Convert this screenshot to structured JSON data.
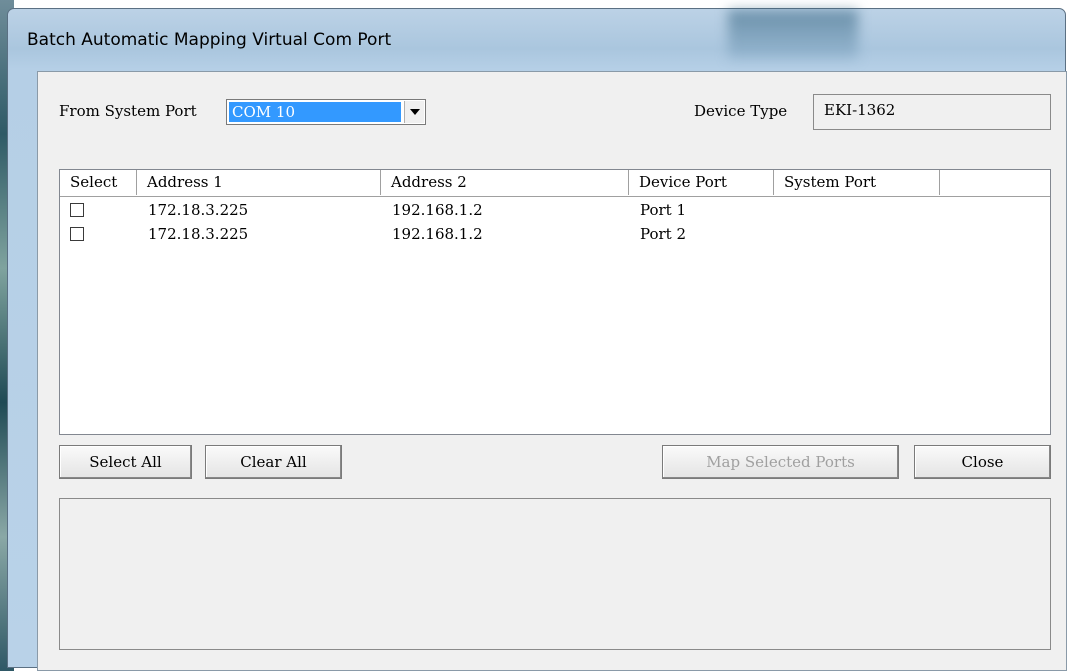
{
  "window": {
    "title": "Batch Automatic Mapping Virtual Com Port"
  },
  "form": {
    "from_system_port_label": "From System Port",
    "from_system_port_value": "COM 10",
    "device_type_label": "Device Type",
    "device_type_value": "EKI-1362"
  },
  "table": {
    "columns": [
      "Select",
      "Address 1",
      "Address 2",
      "Device Port",
      "System Port"
    ],
    "rows": [
      {
        "checked": false,
        "address1": "172.18.3.225",
        "address2": "192.168.1.2",
        "device_port": "Port 1",
        "system_port": ""
      },
      {
        "checked": false,
        "address1": "172.18.3.225",
        "address2": "192.168.1.2",
        "device_port": "Port 2",
        "system_port": ""
      }
    ]
  },
  "buttons": {
    "select_all": "Select All",
    "clear_all": "Clear All",
    "map_selected": "Map Selected Ports",
    "map_selected_enabled": false,
    "close": "Close"
  },
  "icons": {
    "dropdown": "chevron-down-icon"
  }
}
